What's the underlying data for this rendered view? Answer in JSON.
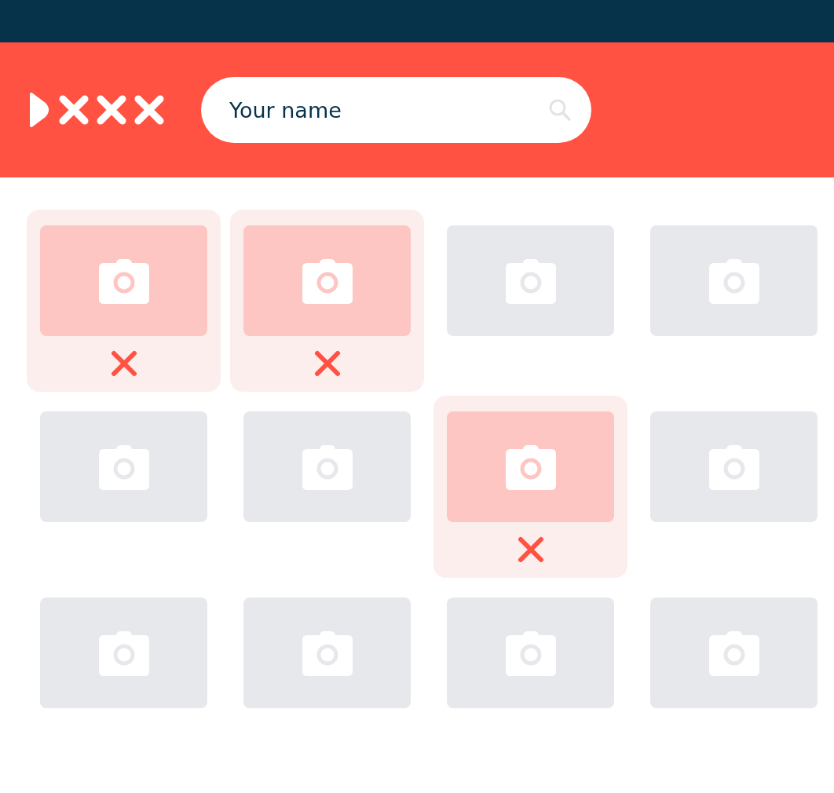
{
  "search": {
    "value": "Your name"
  },
  "photos": [
    {
      "rejected": true
    },
    {
      "rejected": true
    },
    {
      "rejected": false
    },
    {
      "rejected": false
    },
    {
      "rejected": false
    },
    {
      "rejected": false
    },
    {
      "rejected": true
    },
    {
      "rejected": false
    },
    {
      "rejected": false
    },
    {
      "rejected": false
    },
    {
      "rejected": false
    },
    {
      "rejected": false
    }
  ]
}
